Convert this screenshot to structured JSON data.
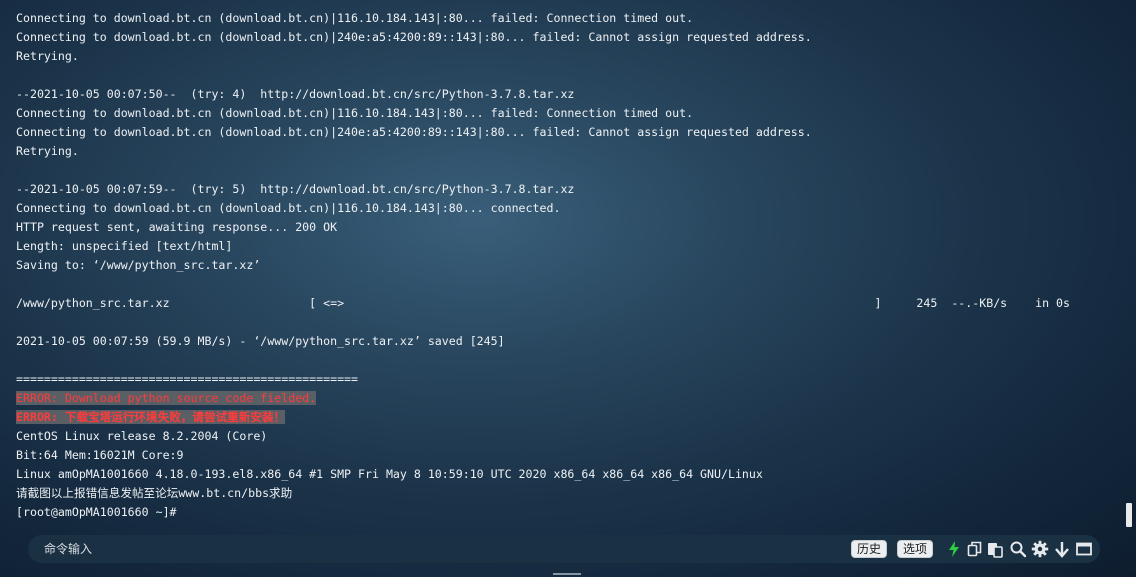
{
  "terminal": {
    "lines": [
      {
        "text": "Connecting to download.bt.cn (download.bt.cn)|116.10.184.143|:80... failed: Connection timed out.",
        "style": "normal"
      },
      {
        "text": "Connecting to download.bt.cn (download.bt.cn)|240e:a5:4200:89::143|:80... failed: Cannot assign requested address.",
        "style": "normal"
      },
      {
        "text": "Retrying.",
        "style": "normal"
      },
      {
        "text": "",
        "style": "normal"
      },
      {
        "text": "--2021-10-05 00:07:50--  (try: 4)  http://download.bt.cn/src/Python-3.7.8.tar.xz",
        "style": "normal"
      },
      {
        "text": "Connecting to download.bt.cn (download.bt.cn)|116.10.184.143|:80... failed: Connection timed out.",
        "style": "normal"
      },
      {
        "text": "Connecting to download.bt.cn (download.bt.cn)|240e:a5:4200:89::143|:80... failed: Cannot assign requested address.",
        "style": "normal"
      },
      {
        "text": "Retrying.",
        "style": "normal"
      },
      {
        "text": "",
        "style": "normal"
      },
      {
        "text": "--2021-10-05 00:07:59--  (try: 5)  http://download.bt.cn/src/Python-3.7.8.tar.xz",
        "style": "normal"
      },
      {
        "text": "Connecting to download.bt.cn (download.bt.cn)|116.10.184.143|:80... connected.",
        "style": "normal"
      },
      {
        "text": "HTTP request sent, awaiting response... 200 OK",
        "style": "normal"
      },
      {
        "text": "Length: unspecified [text/html]",
        "style": "normal"
      },
      {
        "text": "Saving to: ‘/www/python_src.tar.xz’",
        "style": "normal"
      },
      {
        "text": "",
        "style": "normal"
      },
      {
        "text": "/www/python_src.tar.xz                    [ <=>                                                                            ]     245  --.-KB/s    in 0s",
        "style": "normal"
      },
      {
        "text": "",
        "style": "normal"
      },
      {
        "text": "2021-10-05 00:07:59 (59.9 MB/s) - ‘/www/python_src.tar.xz’ saved [245]",
        "style": "normal"
      },
      {
        "text": "",
        "style": "normal"
      },
      {
        "text": "=================================================",
        "style": "normal"
      },
      {
        "text": "ERROR: Download python source code fielded.",
        "style": "err"
      },
      {
        "text": "ERROR: 下载宝塔运行环境失败，请尝试重新安装！",
        "style": "err2"
      },
      {
        "text": "CentOS Linux release 8.2.2004 (Core)",
        "style": "normal"
      },
      {
        "text": "Bit:64 Mem:16021M Core:9",
        "style": "normal"
      },
      {
        "text": "Linux amOpMA1001660 4.18.0-193.el8.x86_64 #1 SMP Fri May 8 10:59:10 UTC 2020 x86_64 x86_64 x86_64 GNU/Linux",
        "style": "normal"
      },
      {
        "text": "请截图以上报错信息发帖至论坛www.bt.cn/bbs求助",
        "style": "normal"
      },
      {
        "text": "[root@amOpMA1001660 ~]#",
        "style": "normal"
      }
    ]
  },
  "cmdbar": {
    "placeholder": "命令输入",
    "history_label": "历史",
    "options_label": "选项",
    "tools": [
      {
        "name": "lightning-icon",
        "color": "#2ecc40"
      },
      {
        "name": "copy-icon",
        "color": "#e6e9ec"
      },
      {
        "name": "paste-icon",
        "color": "#e6e9ec"
      },
      {
        "name": "search-icon",
        "color": "#e6e9ec"
      },
      {
        "name": "gear-icon",
        "color": "#e6e9ec"
      },
      {
        "name": "arrow-down-icon",
        "color": "#e6e9ec"
      },
      {
        "name": "maximize-icon",
        "color": "#e6e9ec"
      }
    ]
  },
  "colors": {
    "error_text": "#ff3b3b",
    "error_highlight": "#5a5f66",
    "accent_green": "#2ecc40"
  }
}
